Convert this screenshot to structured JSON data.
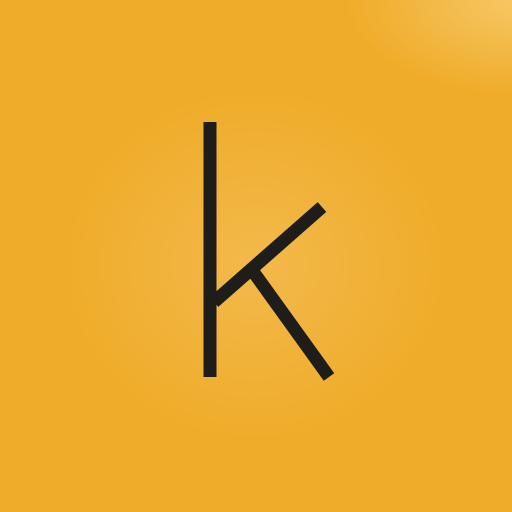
{
  "app_icon": {
    "letter": "k",
    "glyph_color": "#1f1d1a",
    "background_color": "#efac28",
    "highlight_color": "#f3b94a"
  }
}
